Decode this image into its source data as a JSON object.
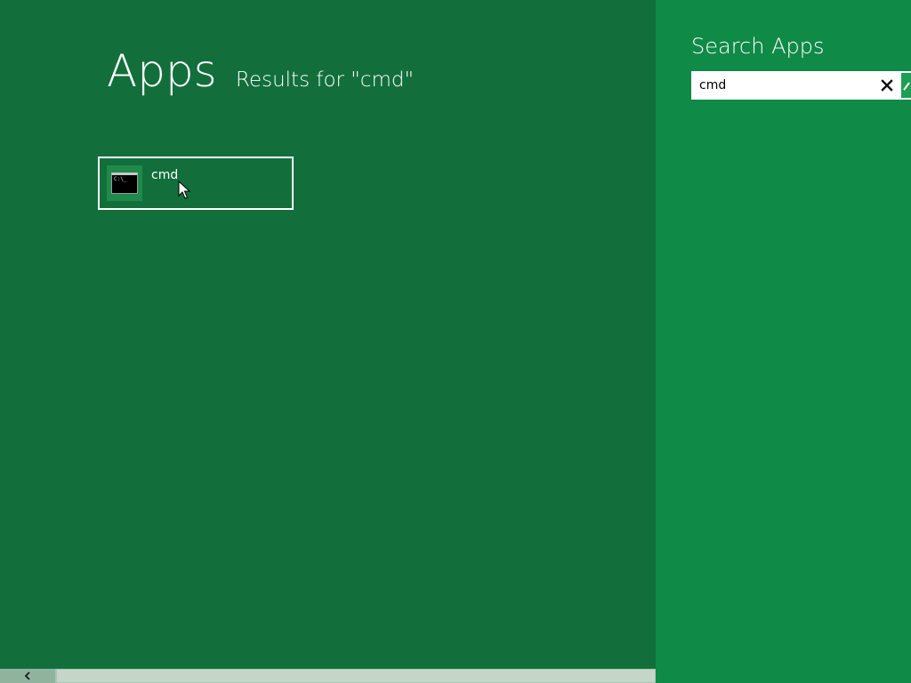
{
  "main": {
    "heading": "Apps",
    "results_label": "Results for \"cmd\"",
    "results": [
      {
        "label": "cmd",
        "icon": "command-prompt-icon",
        "icon_text": "C:\\_"
      }
    ]
  },
  "search_pane": {
    "title": "Search Apps",
    "query": "cmd",
    "clear_icon": "close-icon",
    "go_icon": "search-arrow-icon"
  },
  "scrollbar": {
    "left_icon": "chevron-left-icon"
  },
  "colors": {
    "background": "#126f3b",
    "search_pane": "#0f8a47",
    "accent": "#1c9f52"
  }
}
